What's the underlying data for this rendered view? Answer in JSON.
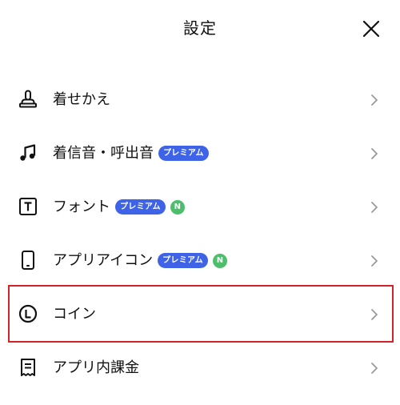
{
  "header": {
    "title": "設定",
    "close_icon": "close-icon"
  },
  "menu": {
    "items": [
      {
        "label": "着せかえ",
        "icon": "brush-icon",
        "premium": false,
        "new": false
      },
      {
        "label": "着信音・呼出音",
        "icon": "music-note-icon",
        "premium": true,
        "new": false
      },
      {
        "label": "フォント",
        "icon": "text-font-icon",
        "premium": true,
        "new": true
      },
      {
        "label": "アプリアイコン",
        "icon": "phone-icon",
        "premium": true,
        "new": true
      },
      {
        "label": "コイン",
        "icon": "coin-icon",
        "premium": false,
        "new": false,
        "highlighted": true
      },
      {
        "label": "アプリ内課金",
        "icon": "receipt-icon",
        "premium": false,
        "new": false
      }
    ]
  },
  "badges": {
    "premium_label": "プレミアム",
    "new_label": "N"
  },
  "colors": {
    "premium_badge": "#3f63e6",
    "new_badge": "#4cbe6c",
    "highlight_border": "#d2232a",
    "chevron": "#9a9a9a"
  }
}
